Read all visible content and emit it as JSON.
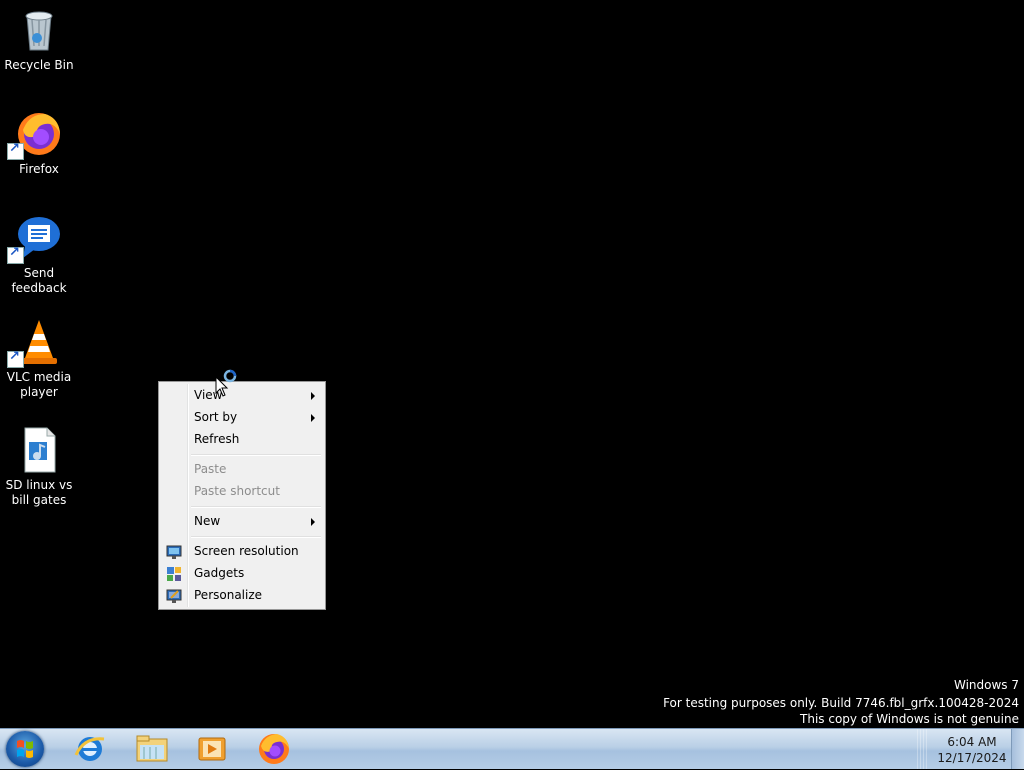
{
  "desktop": {
    "icons": [
      {
        "label": "Recycle Bin",
        "icon": "recycle-bin-icon"
      },
      {
        "label": "Firefox",
        "icon": "firefox-icon"
      },
      {
        "label": "Send\nfeedback",
        "icon": "send-feedback-icon"
      },
      {
        "label": "VLC media\nplayer",
        "icon": "vlc-icon"
      },
      {
        "label": "SD linux vs\nbill gates",
        "icon": "audio-file-icon"
      }
    ]
  },
  "context_menu": {
    "items": [
      {
        "label": "View",
        "submenu": true,
        "enabled": true
      },
      {
        "label": "Sort by",
        "submenu": true,
        "enabled": true
      },
      {
        "label": "Refresh",
        "submenu": false,
        "enabled": true
      },
      {
        "label": "Paste",
        "submenu": false,
        "enabled": false
      },
      {
        "label": "Paste shortcut",
        "submenu": false,
        "enabled": false
      },
      {
        "label": "New",
        "submenu": true,
        "enabled": true
      },
      {
        "label": "Screen resolution",
        "submenu": false,
        "enabled": true,
        "icon": "screen-resolution-icon"
      },
      {
        "label": "Gadgets",
        "submenu": false,
        "enabled": true,
        "icon": "gadgets-icon"
      },
      {
        "label": "Personalize",
        "submenu": false,
        "enabled": true,
        "icon": "personalize-icon"
      }
    ]
  },
  "watermark": {
    "line1": "Windows 7",
    "line2": "For testing purposes only. Build 7746.fbl_grfx.100428-2024",
    "line3": "This copy of Windows is not genuine"
  },
  "taskbar": {
    "pinned": [
      "internet-explorer-icon",
      "windows-explorer-icon",
      "media-player-icon",
      "firefox-icon"
    ],
    "clock": {
      "time": "6:04 AM",
      "date": "12/17/2024"
    }
  }
}
